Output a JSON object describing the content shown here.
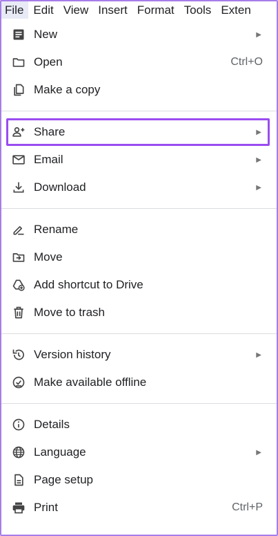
{
  "menubar": {
    "items": [
      "File",
      "Edit",
      "View",
      "Insert",
      "Format",
      "Tools",
      "Exten"
    ]
  },
  "menu": {
    "new": {
      "label": "New",
      "icon": "document-icon"
    },
    "open": {
      "label": "Open",
      "shortcut": "Ctrl+O",
      "icon": "folder-icon"
    },
    "copy": {
      "label": "Make a copy",
      "icon": "copy-icon"
    },
    "share": {
      "label": "Share",
      "icon": "person-add-icon"
    },
    "email": {
      "label": "Email",
      "icon": "mail-icon"
    },
    "download": {
      "label": "Download",
      "icon": "download-icon"
    },
    "rename": {
      "label": "Rename",
      "icon": "edit-icon"
    },
    "move": {
      "label": "Move",
      "icon": "move-folder-icon"
    },
    "shortcut": {
      "label": "Add shortcut to Drive",
      "icon": "drive-add-icon"
    },
    "trash": {
      "label": "Move to trash",
      "icon": "trash-icon"
    },
    "version": {
      "label": "Version history",
      "icon": "history-icon"
    },
    "offline": {
      "label": "Make available offline",
      "icon": "offline-check-icon"
    },
    "details": {
      "label": "Details",
      "icon": "info-icon"
    },
    "language": {
      "label": "Language",
      "icon": "globe-icon"
    },
    "pagesetup": {
      "label": "Page setup",
      "icon": "page-icon"
    },
    "print": {
      "label": "Print",
      "shortcut": "Ctrl+P",
      "icon": "printer-icon"
    }
  },
  "colors": {
    "highlight": "#9a4cf0",
    "frame": "#a67ee8",
    "text": "#202124"
  }
}
